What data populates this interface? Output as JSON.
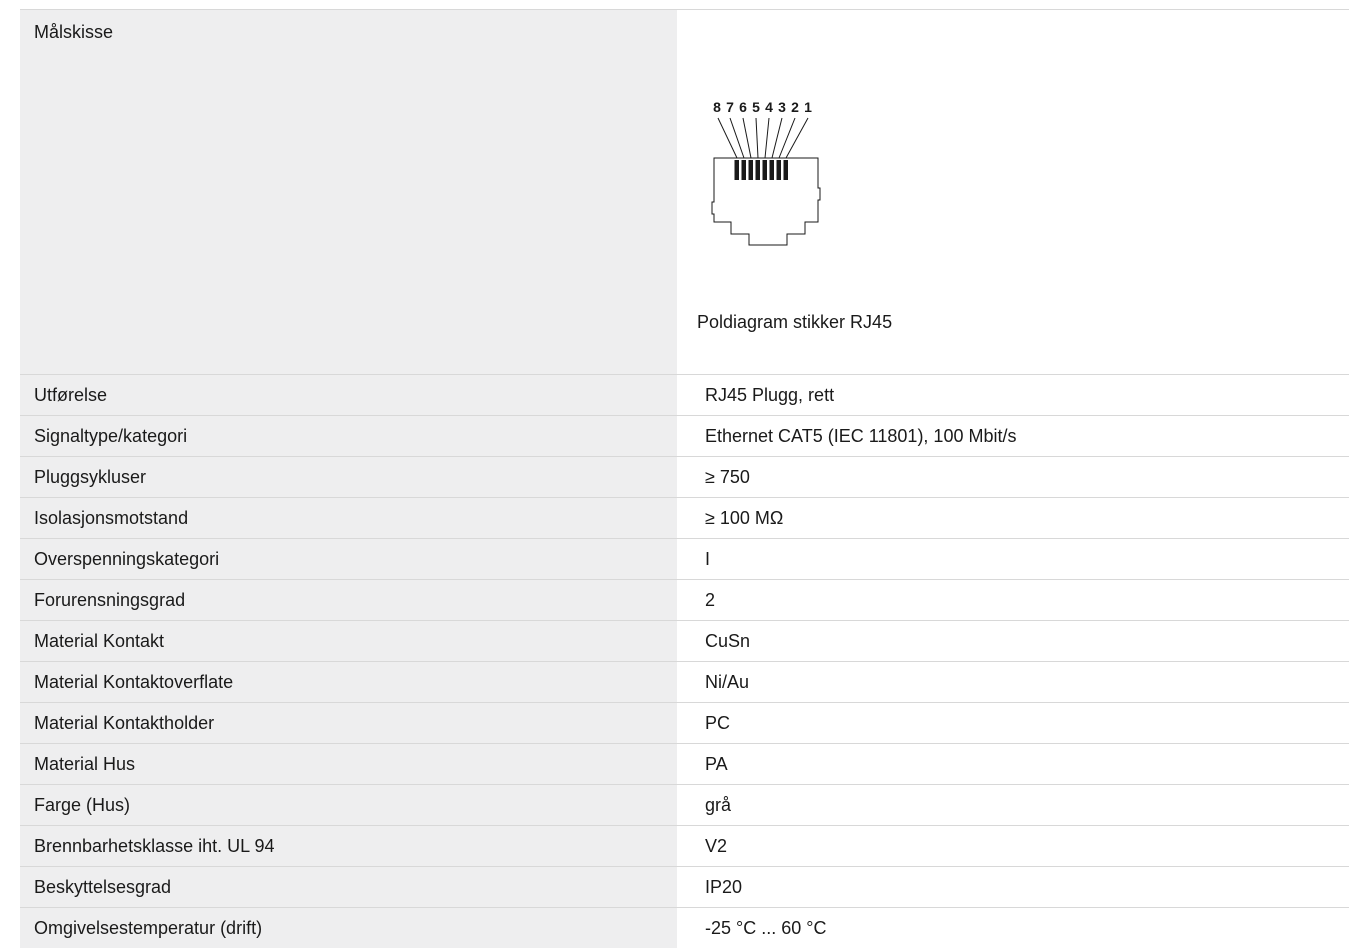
{
  "sketch": {
    "label": "Målskisse",
    "caption": "Poldiagram stikker RJ45",
    "pin_numbers": [
      "8",
      "7",
      "6",
      "5",
      "4",
      "3",
      "2",
      "1"
    ]
  },
  "specs": [
    {
      "label": "Utførelse",
      "value": "RJ45 Plugg, rett"
    },
    {
      "label": "Signaltype/kategori",
      "value": "Ethernet CAT5 (IEC 11801), 100 Mbit/s"
    },
    {
      "label": "Pluggsykluser",
      "value": "≥ 750"
    },
    {
      "label": "Isolasjonsmotstand",
      "value": "≥ 100 MΩ"
    },
    {
      "label": "Overspenningskategori",
      "value": "I"
    },
    {
      "label": "Forurensningsgrad",
      "value": "2"
    },
    {
      "label": "Material Kontakt",
      "value": "CuSn"
    },
    {
      "label": "Material Kontaktoverflate",
      "value": "Ni/Au"
    },
    {
      "label": "Material Kontaktholder",
      "value": "PC"
    },
    {
      "label": "Material Hus",
      "value": "PA"
    },
    {
      "label": "Farge (Hus)",
      "value": "grå"
    },
    {
      "label": "Brennbarhetsklasse iht. UL 94",
      "value": "V2"
    },
    {
      "label": "Beskyttelsesgrad",
      "value": "IP20"
    },
    {
      "label": "Omgivelsestemperatur (drift)",
      "value": "-25 °C ... 60 °C"
    }
  ]
}
